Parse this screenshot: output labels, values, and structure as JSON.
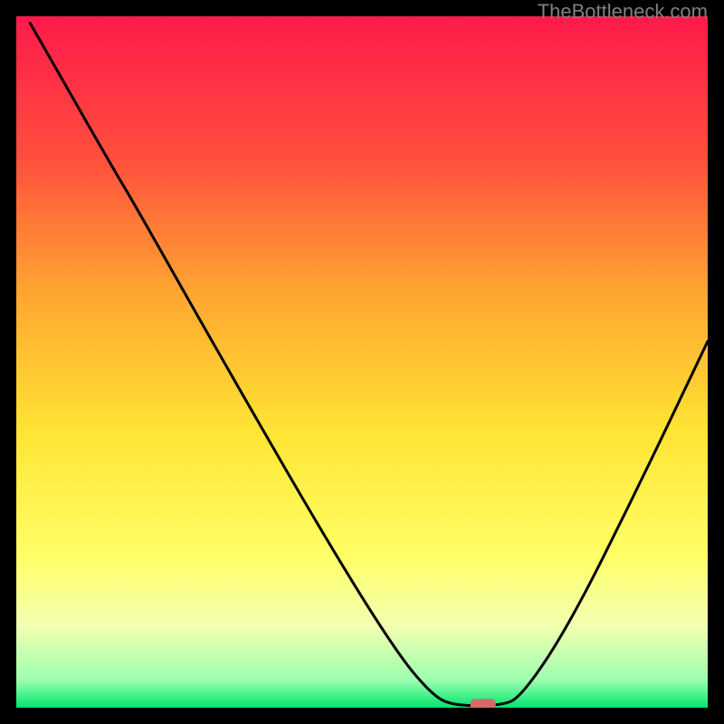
{
  "watermark": "TheBottleneck.com",
  "chart_data": {
    "type": "line",
    "title": "",
    "xlabel": "",
    "ylabel": "",
    "xlim": [
      0,
      100
    ],
    "ylim": [
      0,
      100
    ],
    "gradient_stops": [
      {
        "offset": 0,
        "color": "#ff1a4b"
      },
      {
        "offset": 20,
        "color": "#ff4d3d"
      },
      {
        "offset": 40,
        "color": "#ffa531"
      },
      {
        "offset": 60,
        "color": "#ffe433"
      },
      {
        "offset": 78,
        "color": "#ffff66"
      },
      {
        "offset": 88,
        "color": "#f4ffb0"
      },
      {
        "offset": 96,
        "color": "#9dffb0"
      },
      {
        "offset": 100,
        "color": "#00e66e"
      }
    ],
    "curve": [
      {
        "x": 2.0,
        "y": 99.0
      },
      {
        "x": 6.0,
        "y": 92.0
      },
      {
        "x": 14.0,
        "y": 78.0
      },
      {
        "x": 17.0,
        "y": 73.0
      },
      {
        "x": 30.0,
        "y": 50.0
      },
      {
        "x": 45.0,
        "y": 24.0
      },
      {
        "x": 55.0,
        "y": 8.0
      },
      {
        "x": 60.0,
        "y": 2.0
      },
      {
        "x": 63.0,
        "y": 0.3
      },
      {
        "x": 70.0,
        "y": 0.3
      },
      {
        "x": 73.0,
        "y": 1.5
      },
      {
        "x": 80.0,
        "y": 12.0
      },
      {
        "x": 90.0,
        "y": 32.0
      },
      {
        "x": 100.0,
        "y": 53.0
      }
    ],
    "marker": {
      "x": 67.5,
      "y": 0.5,
      "color": "#d46a6a"
    }
  }
}
